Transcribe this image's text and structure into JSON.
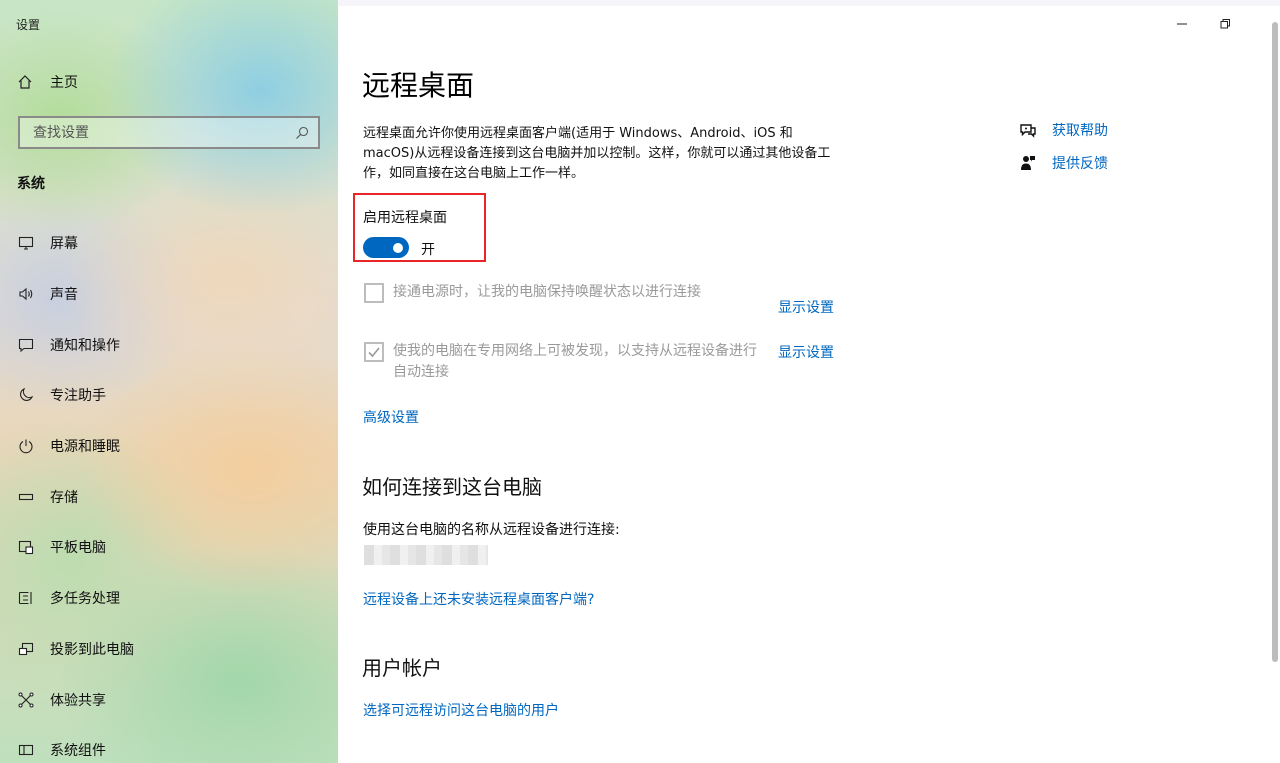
{
  "sidebar": {
    "window_title": "设置",
    "home_label": "主页",
    "search_placeholder": "查找设置",
    "section_label": "系统",
    "items": [
      {
        "label": "屏幕",
        "icon": "monitor-icon"
      },
      {
        "label": "声音",
        "icon": "speaker-icon"
      },
      {
        "label": "通知和操作",
        "icon": "notification-icon"
      },
      {
        "label": "专注助手",
        "icon": "moon-icon"
      },
      {
        "label": "电源和睡眠",
        "icon": "power-icon"
      },
      {
        "label": "存储",
        "icon": "storage-icon"
      },
      {
        "label": "平板电脑",
        "icon": "tablet-icon"
      },
      {
        "label": "多任务处理",
        "icon": "multitask-icon"
      },
      {
        "label": "投影到此电脑",
        "icon": "project-icon"
      },
      {
        "label": "体验共享",
        "icon": "share-icon"
      },
      {
        "label": "系统组件",
        "icon": "components-icon"
      }
    ]
  },
  "window": {
    "minimize_icon": "minimize-icon",
    "restore_icon": "restore-icon"
  },
  "main": {
    "title": "远程桌面",
    "description": "远程桌面允许你使用远程桌面客户端(适用于 Windows、Android、iOS 和 macOS)从远程设备连接到这台电脑并加以控制。这样，你就可以通过其他设备工作，如同直接在这台电脑上工作一样。",
    "toggle": {
      "label": "启用远程桌面",
      "state_text": "开",
      "checked": true,
      "accent": "#0067c0",
      "highlight_color": "#e8262a"
    },
    "options": [
      {
        "label": "接通电源时，让我的电脑保持唤醒状态以进行连接",
        "checked": false,
        "link": "显示设置"
      },
      {
        "label": "使我的电脑在专用网络上可被发现，以支持从远程设备进行自动连接",
        "checked": true,
        "link": "显示设置"
      }
    ],
    "advanced_link": "高级设置",
    "connect_section": {
      "heading": "如何连接到这台电脑",
      "text": "使用这台电脑的名称从远程设备进行连接:",
      "client_link": "远程设备上还未安装远程桌面客户端?"
    },
    "accounts_section": {
      "heading": "用户帐户",
      "link": "选择可远程访问这台电脑的用户"
    }
  },
  "help": {
    "get_help": "获取帮助",
    "feedback": "提供反馈"
  }
}
